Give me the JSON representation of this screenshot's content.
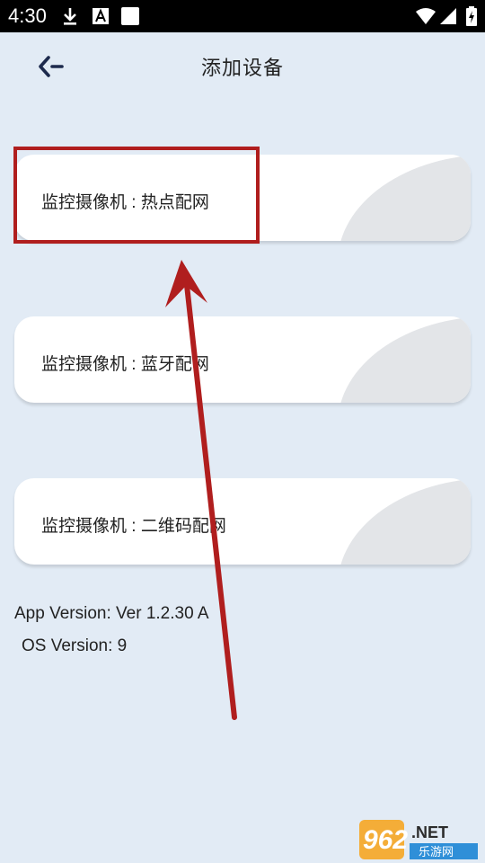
{
  "status_bar": {
    "time": "4:30",
    "icons": [
      "download-icon",
      "a-notification-icon",
      "blank-notification-icon",
      "wifi-icon",
      "signal-icon",
      "battery-charging-icon"
    ]
  },
  "header": {
    "title": "添加设备",
    "back_icon": "back-arrow-icon"
  },
  "options": [
    {
      "label": "监控摄像机 : 热点配网"
    },
    {
      "label": "监控摄像机 : 蓝牙配网"
    },
    {
      "label": "监控摄像机 : 二维码配网"
    }
  ],
  "footer": {
    "app_version": "App Version: Ver 1.2.30 A",
    "os_version": "OS Version: 9"
  },
  "annotation": {
    "color": "#b01e1e"
  },
  "watermark": {
    "number": "962",
    "suffix": ".NET",
    "subtitle": "乐游网"
  },
  "colors": {
    "background": "#e2ebf5",
    "card": "#ffffff",
    "title_text": "#222222",
    "back_arrow": "#1d2a4d"
  }
}
